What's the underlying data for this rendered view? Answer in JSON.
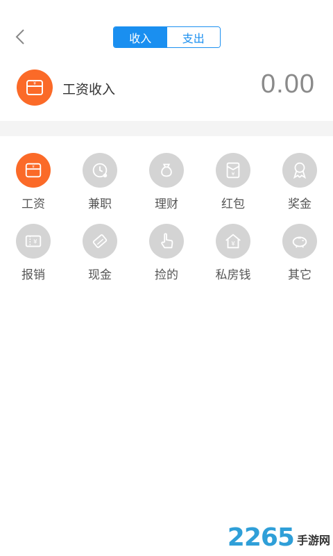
{
  "header": {
    "back_icon": "chevron-left-icon",
    "tabs": [
      {
        "label": "收入",
        "active": true
      },
      {
        "label": "支出",
        "active": false
      }
    ]
  },
  "selected": {
    "icon": "wallet-icon",
    "label": "工资收入",
    "amount": "0.00"
  },
  "categories": [
    {
      "label": "工资",
      "icon": "wallet-icon",
      "selected": true
    },
    {
      "label": "兼职",
      "icon": "clock-icon",
      "selected": false
    },
    {
      "label": "理财",
      "icon": "money-bag-icon",
      "selected": false
    },
    {
      "label": "红包",
      "icon": "red-envelope-icon",
      "selected": false
    },
    {
      "label": "奖金",
      "icon": "medal-icon",
      "selected": false
    },
    {
      "label": "报销",
      "icon": "receipt-icon",
      "selected": false
    },
    {
      "label": "现金",
      "icon": "cash-icon",
      "selected": false
    },
    {
      "label": "捡的",
      "icon": "hand-pointer-icon",
      "selected": false
    },
    {
      "label": "私房钱",
      "icon": "house-money-icon",
      "selected": false
    },
    {
      "label": "其它",
      "icon": "piggy-bank-icon",
      "selected": false
    }
  ],
  "watermark": {
    "number": "2265",
    "text": "手游网"
  },
  "colors": {
    "accent": "#1a8ff0",
    "selected": "#fb6a28",
    "icon_bg": "#d4d4d4"
  }
}
